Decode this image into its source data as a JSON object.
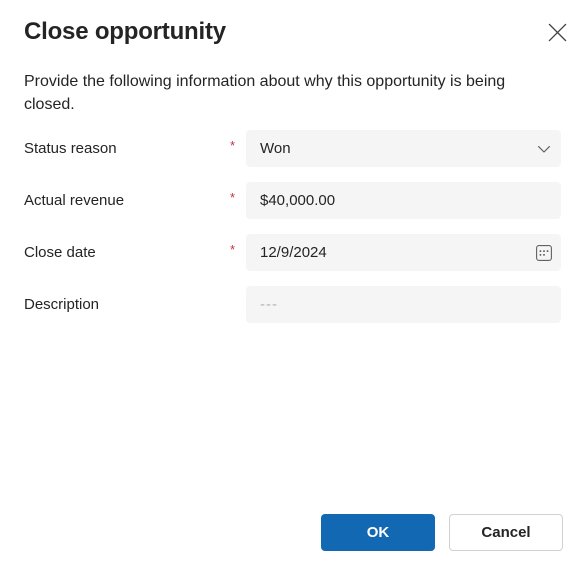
{
  "dialog": {
    "title": "Close opportunity",
    "subtitle": "Provide the following information about why this opportunity is being closed.",
    "close_icon": "close-icon",
    "accent_color": "#1268b3",
    "required_color": "#c4314b",
    "field_background": "#f5f5f5"
  },
  "fields": [
    {
      "label": "Status reason",
      "required": true,
      "required_mark": "*",
      "value": "Won",
      "type": "dropdown",
      "affordance_icon": "chevron-down-icon",
      "is_placeholder": false
    },
    {
      "label": "Actual revenue",
      "required": true,
      "required_mark": "*",
      "value": "$40,000.00",
      "type": "text",
      "affordance_icon": "",
      "is_placeholder": false
    },
    {
      "label": "Close date",
      "required": true,
      "required_mark": "*",
      "value": "12/9/2024",
      "type": "date",
      "affordance_icon": "calendar-icon",
      "is_placeholder": false
    },
    {
      "label": "Description",
      "required": false,
      "required_mark": "",
      "value": "---",
      "type": "text",
      "affordance_icon": "",
      "is_placeholder": true
    }
  ],
  "footer": {
    "ok_label": "OK",
    "cancel_label": "Cancel"
  }
}
